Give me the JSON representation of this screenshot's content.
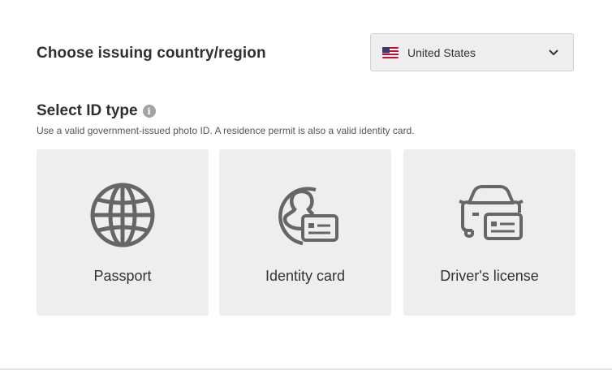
{
  "country": {
    "label": "Choose issuing country/region",
    "selected": "United States",
    "flag_icon": "us-flag-icon"
  },
  "id_type": {
    "title": "Select ID type",
    "hint": "Use a valid government-issued photo ID. A residence permit is also a valid identity card.",
    "options": [
      {
        "label": "Passport",
        "icon": "globe-icon"
      },
      {
        "label": "Identity card",
        "icon": "person-id-card-icon"
      },
      {
        "label": "Driver's license",
        "icon": "car-id-card-icon"
      }
    ]
  },
  "colors": {
    "card_bg": "#eeeeee",
    "icon_color": "#666666",
    "text_color": "#333333"
  }
}
